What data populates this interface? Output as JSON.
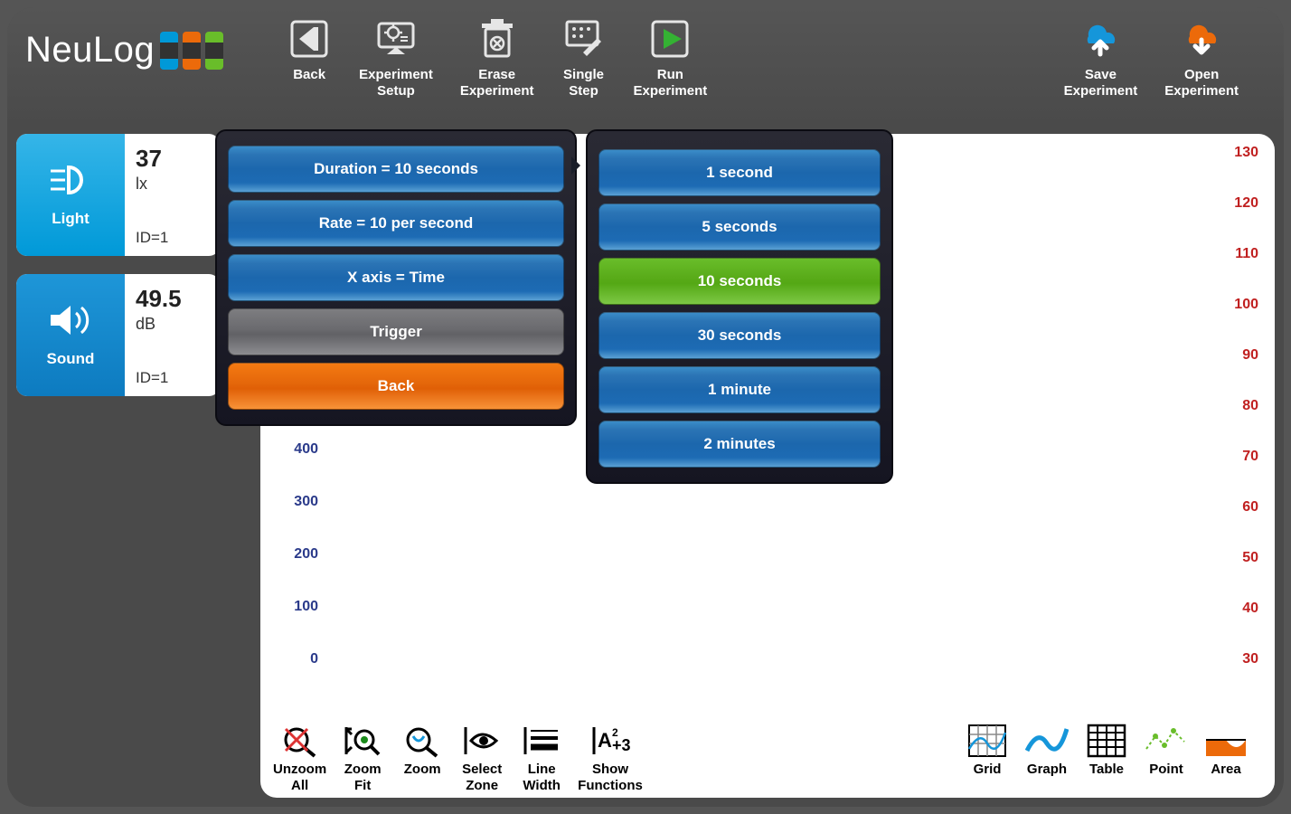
{
  "brand": "NeuLog",
  "toolbar": [
    {
      "id": "back",
      "label": "Back"
    },
    {
      "id": "exp-setup",
      "label": "Experiment\nSetup"
    },
    {
      "id": "erase-exp",
      "label": "Erase\nExperiment"
    },
    {
      "id": "single-step",
      "label": "Single\nStep"
    },
    {
      "id": "run-exp",
      "label": "Run\nExperiment"
    }
  ],
  "toolbar_right": [
    {
      "id": "save-exp",
      "label": "Save\nExperiment"
    },
    {
      "id": "open-exp",
      "label": "Open\nExperiment"
    }
  ],
  "sensors": [
    {
      "name": "Light",
      "value": "37",
      "unit": "lx",
      "id": "ID=1"
    },
    {
      "name": "Sound",
      "value": "49.5",
      "unit": "dB",
      "id": "ID=1"
    }
  ],
  "setup_menu": [
    {
      "label": "Duration = 10 seconds",
      "style": "blue"
    },
    {
      "label": "Rate = 10 per second",
      "style": "blue"
    },
    {
      "label": "X axis = Time",
      "style": "blue"
    },
    {
      "label": "Trigger",
      "style": "gray"
    },
    {
      "label": "Back",
      "style": "orange"
    }
  ],
  "duration_options": [
    {
      "label": "1 second",
      "selected": false
    },
    {
      "label": "5 seconds",
      "selected": false
    },
    {
      "label": "10 seconds",
      "selected": true
    },
    {
      "label": "30 seconds",
      "selected": false
    },
    {
      "label": "1 minute",
      "selected": false
    },
    {
      "label": "2 minutes",
      "selected": false
    }
  ],
  "bottom_tools_left": [
    {
      "id": "unzoom-all",
      "label": "Unzoom\nAll"
    },
    {
      "id": "zoom-fit",
      "label": "Zoom\nFit"
    },
    {
      "id": "zoom",
      "label": "Zoom"
    },
    {
      "id": "select-zone",
      "label": "Select\nZone"
    },
    {
      "id": "line-width",
      "label": "Line\nWidth"
    },
    {
      "id": "show-functions",
      "label": "Show\nFunctions"
    }
  ],
  "bottom_tools_right": [
    {
      "id": "grid",
      "label": "Grid"
    },
    {
      "id": "graph",
      "label": "Graph"
    },
    {
      "id": "table",
      "label": "Table"
    },
    {
      "id": "point",
      "label": "Point"
    },
    {
      "id": "area",
      "label": "Area"
    }
  ],
  "chart_data": {
    "type": "line",
    "left_axis": {
      "ticks": [
        400,
        300,
        200,
        100,
        0
      ],
      "positions": [
        0,
        58,
        116,
        174,
        232
      ],
      "color": "#2a3a8a"
    },
    "right_axis": {
      "ticks": [
        130,
        120,
        110,
        100,
        90,
        80,
        70,
        60,
        50,
        40,
        30
      ],
      "positions": [
        0,
        56,
        112,
        168,
        224,
        280,
        336,
        392,
        448,
        504,
        560
      ],
      "color": "#c02020"
    },
    "title": "",
    "xlabel": "",
    "x_is": "Time"
  }
}
